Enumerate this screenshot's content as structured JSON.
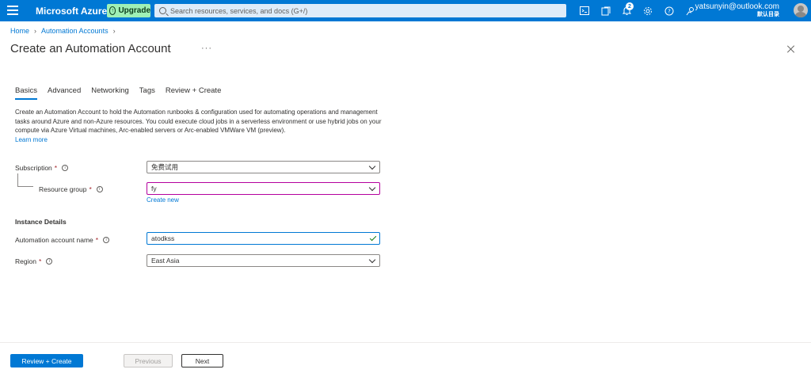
{
  "topbar": {
    "brand": "Microsoft Azure",
    "upgrade_label": "Upgrade",
    "search_placeholder": "Search resources, services, and docs (G+/)",
    "notification_count": "2",
    "user_email": "yatsunyin@outlook.com",
    "user_directory": "默认目录",
    "accent_color": "#0078d4",
    "icons": [
      "menu-icon",
      "cloud-shell-icon",
      "directory-filter-icon",
      "bell-icon",
      "gear-icon",
      "help-icon",
      "feedback-icon"
    ]
  },
  "breadcrumb": {
    "items": [
      "Home",
      "Automation Accounts"
    ]
  },
  "page": {
    "title": "Create an Automation Account",
    "more": "···"
  },
  "tabs": [
    {
      "label": "Basics",
      "active": true
    },
    {
      "label": "Advanced",
      "active": false
    },
    {
      "label": "Networking",
      "active": false
    },
    {
      "label": "Tags",
      "active": false
    },
    {
      "label": "Review + Create",
      "active": false
    }
  ],
  "description": {
    "text": "Create an Automation Account to hold the Automation runbooks & configuration used for automating operations and management tasks around Azure and non-Azure resources. You could execute cloud jobs in a serverless environment or use hybrid jobs on your compute via Azure Virtual machines, Arc-enabled servers or Arc-enabled VMWare VM (preview).",
    "link": "Learn more"
  },
  "form": {
    "subscription": {
      "label": "Subscription",
      "value": "免费试用"
    },
    "resource_group": {
      "label": "Resource group",
      "value": "fy",
      "create_new": "Create new"
    },
    "instance_details": "Instance Details",
    "account_name": {
      "label": "Automation account name",
      "value": "atodkss"
    },
    "region": {
      "label": "Region",
      "value": "East Asia"
    }
  },
  "footer": {
    "review_create": "Review + Create",
    "previous": "Previous",
    "next": "Next"
  }
}
